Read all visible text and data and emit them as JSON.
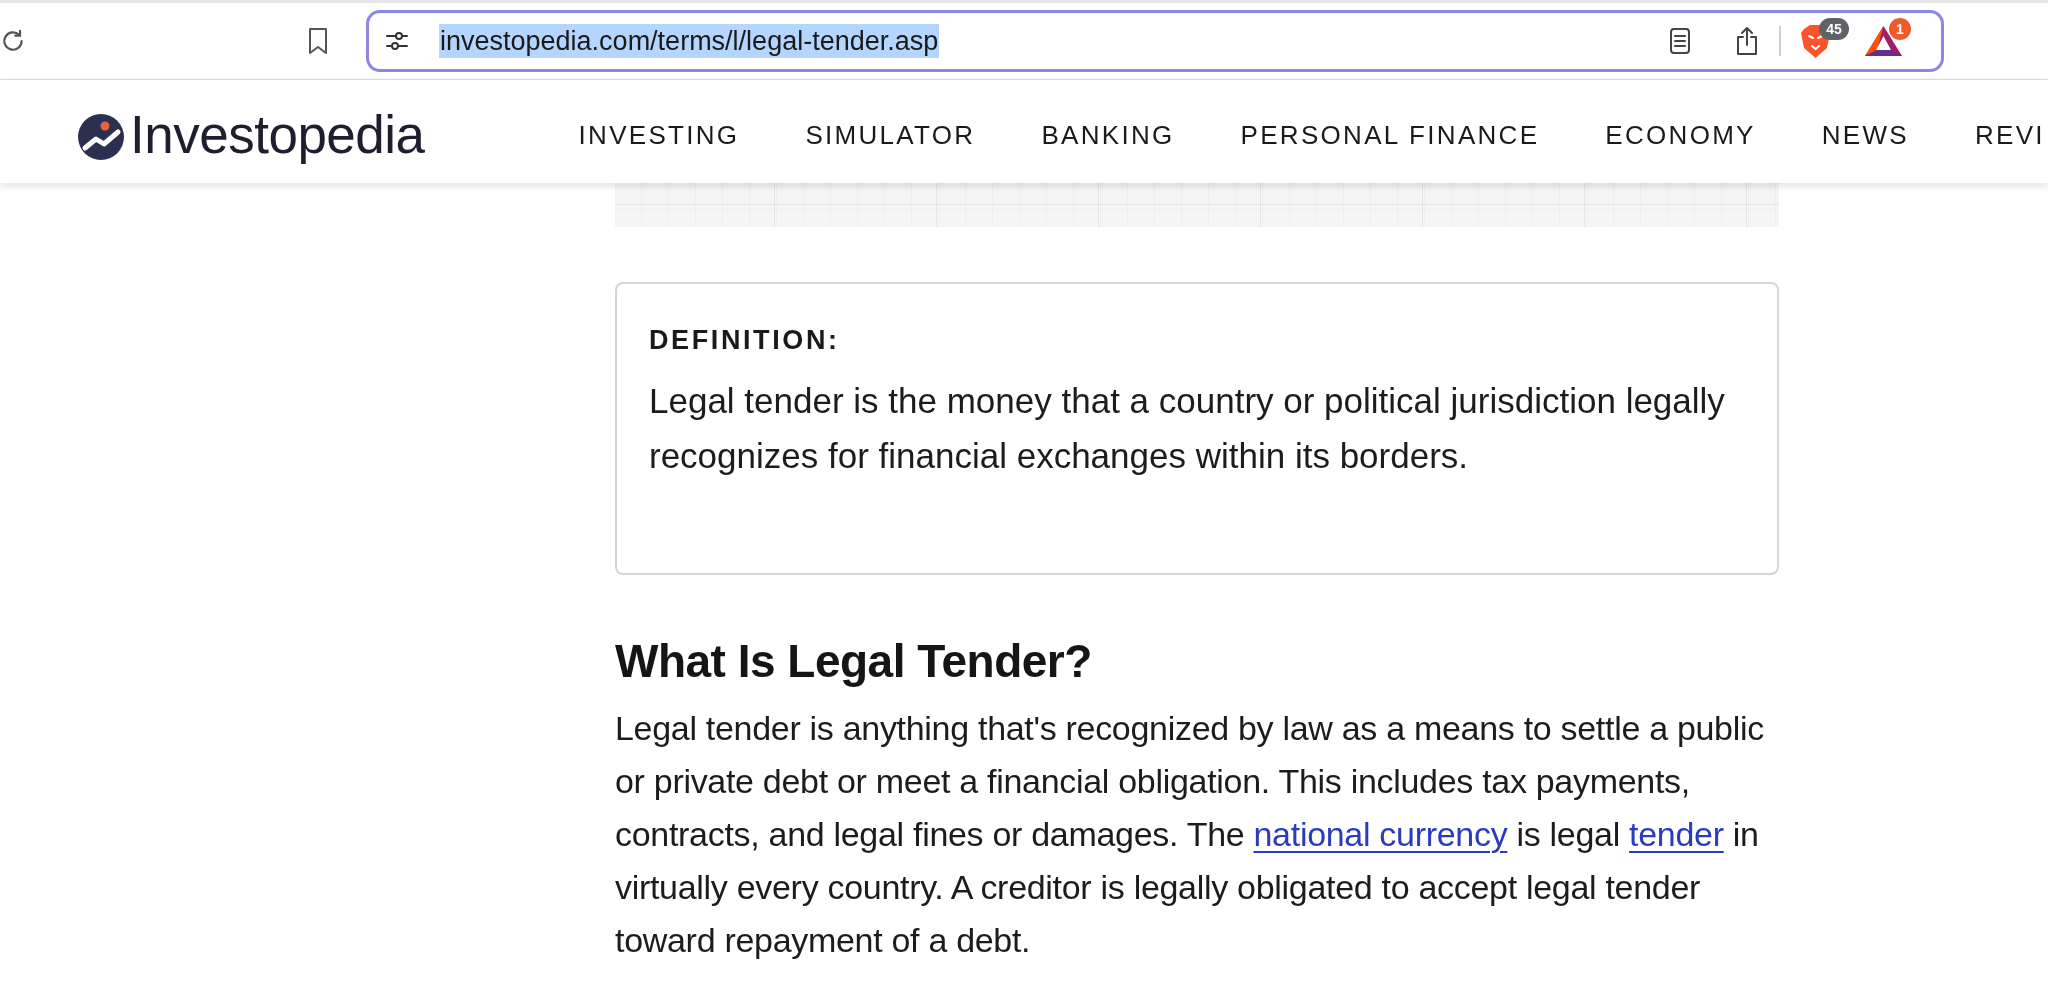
{
  "browser": {
    "url": "investopedia.com/terms/l/legal-tender.asp",
    "url_highlighted": true,
    "extensions": [
      {
        "kind": "shield",
        "badge": "45"
      },
      {
        "kind": "rewards",
        "badge": "1"
      }
    ]
  },
  "site_header": {
    "logo": "Investopedia",
    "nav_items": [
      "INVESTING",
      "SIMULATOR",
      "BANKING",
      "PERSONAL FINANCE",
      "ECONOMY",
      "NEWS",
      "REVI"
    ]
  },
  "definition": {
    "label": "DEFINITION:",
    "text": "Legal tender is the money that a country or political jurisdiction legally recognizes for financial exchanges within its borders."
  },
  "article": {
    "heading": "What Is Legal Tender?",
    "paragraph": [
      {
        "kind": "text",
        "text": "Legal tender is anything that's recognized by law as a means to settle a public or private debt or meet a financial obligation. This includes tax payments, contracts, and legal fines or damages. The "
      },
      {
        "kind": "link",
        "text": "national currency"
      },
      {
        "kind": "text",
        "text": " is legal "
      },
      {
        "kind": "link",
        "text": "tender"
      },
      {
        "kind": "text",
        "text": " in virtually every country. A creditor is legally obligated to accept legal tender toward repayment of a debt."
      }
    ]
  }
}
